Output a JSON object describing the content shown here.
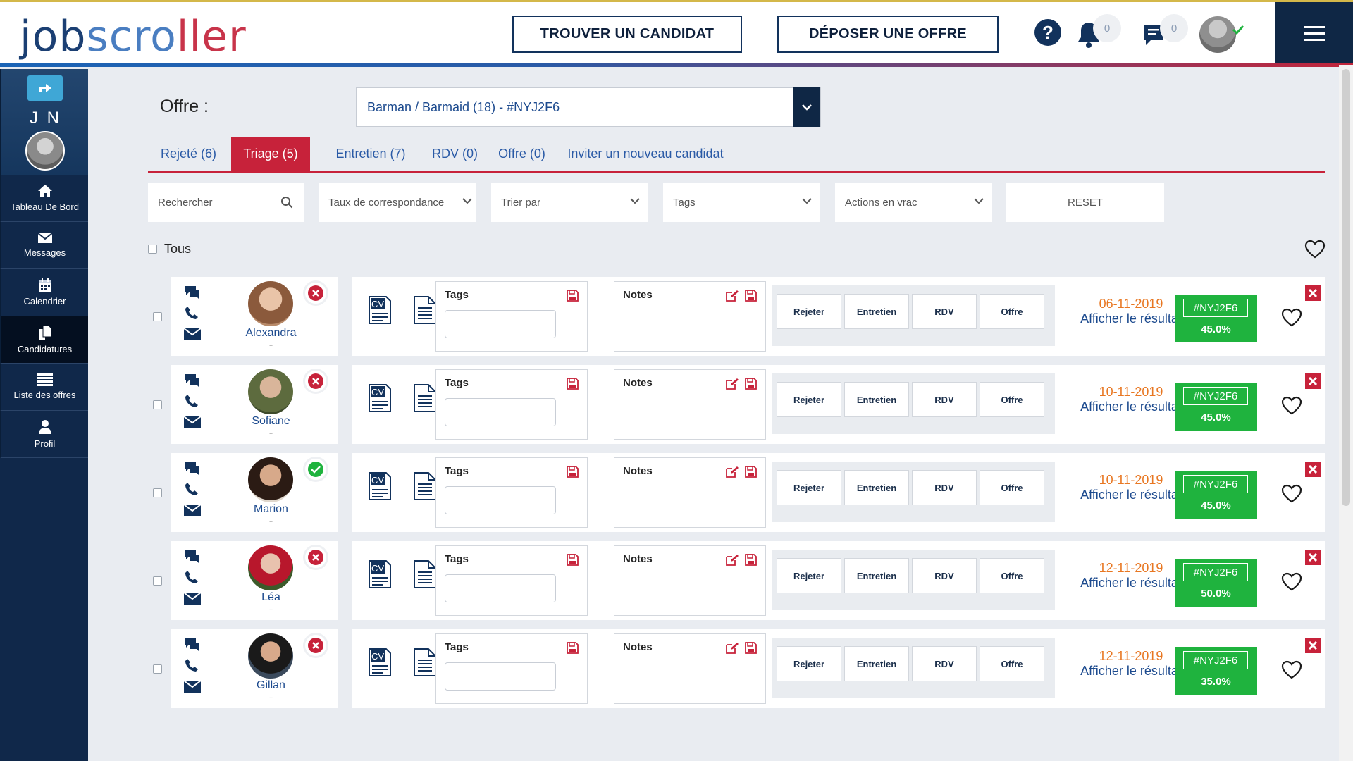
{
  "header": {
    "logo": {
      "part1": "job",
      "part2": "scro",
      "part3": "ller"
    },
    "find_candidate_label": "TROUVER UN CANDIDAT",
    "post_offer_label": "DÉPOSER UNE OFFRE",
    "notifications_count": "0",
    "messages_count": "0"
  },
  "sidebar": {
    "user_initials": "J N",
    "items": [
      {
        "label": "Tableau De Bord",
        "icon": "home-icon"
      },
      {
        "label": "Messages",
        "icon": "envelope-icon"
      },
      {
        "label": "Calendrier",
        "icon": "calendar-icon"
      },
      {
        "label": "Candidatures",
        "icon": "documents-icon"
      },
      {
        "label": "Liste des offres",
        "icon": "list-icon"
      },
      {
        "label": "Profil",
        "icon": "user-icon"
      }
    ]
  },
  "offer": {
    "label": "Offre :",
    "selected": "Barman / Barmaid (18) - #NYJ2F6"
  },
  "tabs": [
    {
      "label": "Rejeté (6)"
    },
    {
      "label": "Triage (5)"
    },
    {
      "label": "Entretien (7)"
    },
    {
      "label": "RDV (0)"
    },
    {
      "label": "Offre (0)"
    },
    {
      "label": "Inviter un nouveau candidat"
    }
  ],
  "filters": {
    "search_placeholder": "Rechercher",
    "match": "Taux de correspondance",
    "sort": "Trier par",
    "tags": "Tags",
    "bulk": "Actions en vrac",
    "reset": "RESET"
  },
  "select_all": "Tous",
  "labels": {
    "tags": "Tags",
    "notes": "Notes",
    "reject": "Rejeter",
    "interview": "Entretien",
    "rdv": "RDV",
    "offer": "Offre",
    "show_result": "Afficher le résultat",
    "cv": "CV"
  },
  "candidates": [
    {
      "name": "Alexandra",
      "dots": "..",
      "status": "rejected",
      "date": "06-11-2019",
      "code": "#NYJ2F6",
      "score": "45.0%"
    },
    {
      "name": "Sofiane",
      "dots": "..",
      "status": "rejected",
      "date": "10-11-2019",
      "code": "#NYJ2F6",
      "score": "45.0%"
    },
    {
      "name": "Marion",
      "dots": "..",
      "status": "accepted",
      "date": "10-11-2019",
      "code": "#NYJ2F6",
      "score": "45.0%"
    },
    {
      "name": "Léa",
      "dots": "..",
      "status": "rejected",
      "date": "12-11-2019",
      "code": "#NYJ2F6",
      "score": "50.0%"
    },
    {
      "name": "Gillan",
      "dots": "..",
      "status": "rejected",
      "date": "12-11-2019",
      "code": "#NYJ2F6",
      "score": "35.0%"
    }
  ],
  "colors": {
    "navy": "#0f2745",
    "accent_red": "#c7223a",
    "score_green": "#1fb33e",
    "date_orange": "#e87722",
    "link_blue": "#1c4a8e"
  }
}
